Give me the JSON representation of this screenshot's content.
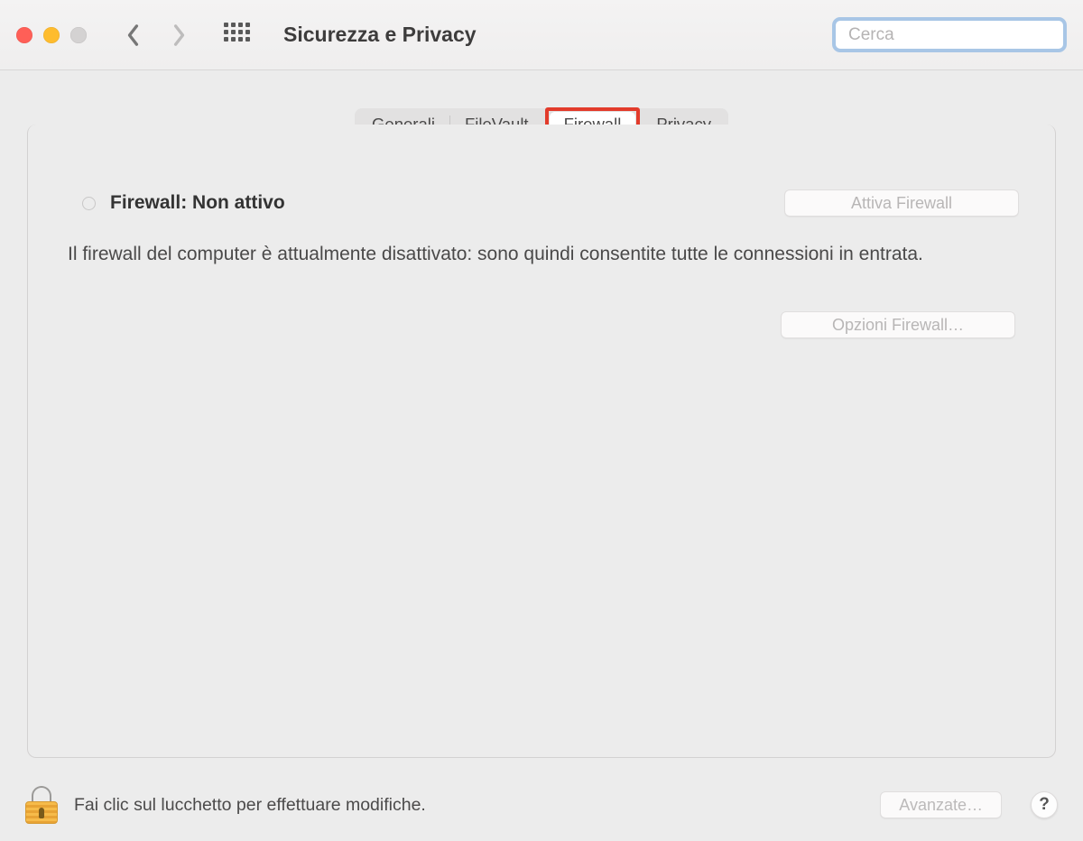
{
  "toolbar": {
    "title": "Sicurezza e Privacy",
    "search_placeholder": "Cerca"
  },
  "tabs": {
    "general": "Generali",
    "filevault": "FileVault",
    "firewall": "Firewall",
    "privacy": "Privacy"
  },
  "firewall": {
    "status_label": "Firewall: Non attivo",
    "activate_button": "Attiva Firewall",
    "description": "Il firewall del computer è attualmente disattivato: sono quindi consentite tutte le connessioni in entrata.",
    "options_button": "Opzioni Firewall…"
  },
  "footer": {
    "lock_hint": "Fai clic sul lucchetto per effettuare modifiche.",
    "advanced_button": "Avanzate…",
    "help_label": "?"
  }
}
